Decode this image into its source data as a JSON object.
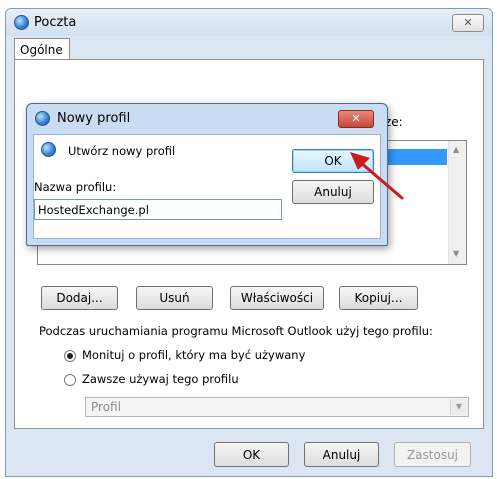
{
  "main_window": {
    "title": "Poczta",
    "tab": "Ogólne",
    "hidden_text_right": "ze:",
    "buttons": {
      "add": "Dodaj...",
      "remove": "Usuń",
      "properties": "Właściwości",
      "copy": "Kopiuj..."
    },
    "startup_label": "Podczas uruchamiania programu Microsoft Outlook użyj tego profilu:",
    "radio_prompt": "Monituj o profil, który ma być używany",
    "radio_always": "Zawsze używaj tego profilu",
    "profile_select_value": "Profil",
    "footer": {
      "ok": "OK",
      "cancel": "Anuluj",
      "apply": "Zastosuj"
    }
  },
  "dialog": {
    "title": "Nowy profil",
    "prompt": "Utwórz nowy profil",
    "ok": "OK",
    "cancel": "Anuluj",
    "name_label": "Nazwa profilu:",
    "name_value": "HostedExchange.pl"
  },
  "colors": {
    "annotation_arrow": "#cc1b1b",
    "close_button_red": "#c8463a"
  }
}
